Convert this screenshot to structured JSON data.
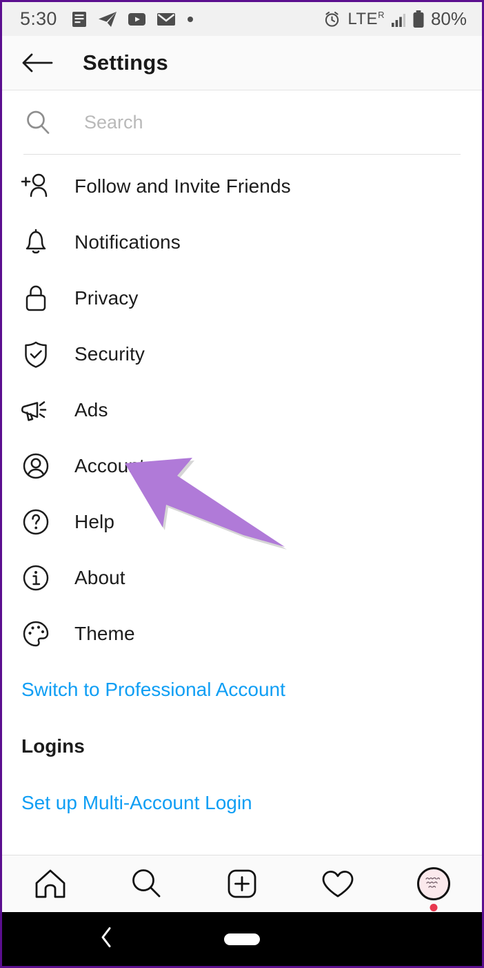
{
  "status_bar": {
    "time": "5:30",
    "left_icons": [
      "news-article-icon",
      "telegram-icon",
      "youtube-icon",
      "gmail-icon",
      "more-dot-icon"
    ],
    "network_label": "LTE",
    "roaming_label": "R",
    "battery_label": "80%",
    "right_icons": [
      "alarm-clock-icon",
      "signal-bars-icon",
      "battery-icon"
    ]
  },
  "header": {
    "back_icon": "arrow-left-icon",
    "title": "Settings"
  },
  "search": {
    "icon": "search-icon",
    "placeholder": "Search",
    "value": ""
  },
  "settings_list": [
    {
      "label": "Follow and Invite Friends",
      "icon": "person-add-icon"
    },
    {
      "label": "Notifications",
      "icon": "bell-icon"
    },
    {
      "label": "Privacy",
      "icon": "lock-icon"
    },
    {
      "label": "Security",
      "icon": "shield-check-icon"
    },
    {
      "label": "Ads",
      "icon": "megaphone-icon"
    },
    {
      "label": "Account",
      "icon": "user-circle-icon"
    },
    {
      "label": "Help",
      "icon": "question-circle-icon"
    },
    {
      "label": "About",
      "icon": "info-circle-icon"
    },
    {
      "label": "Theme",
      "icon": "palette-icon"
    }
  ],
  "links": {
    "switch_professional": "Switch to Professional Account",
    "logins_header": "Logins",
    "multi_account": "Set up Multi-Account Login"
  },
  "annotation": {
    "type": "arrow",
    "points_to": "Security",
    "color": "#b07ad8"
  },
  "bottom_nav": [
    {
      "name": "home-icon"
    },
    {
      "name": "search-icon"
    },
    {
      "name": "add-post-icon"
    },
    {
      "name": "heart-icon"
    },
    {
      "name": "profile-avatar"
    }
  ],
  "android_nav": {
    "back_icon": "chevron-left-icon",
    "home_pill": "home-pill-icon"
  },
  "colors": {
    "link": "#0f9ef4",
    "accent_arrow": "#b07ad8",
    "status_bar_bg": "#f1f1f1",
    "frame_border": "#5b0f8f",
    "badge_dot": "#e8384f"
  }
}
